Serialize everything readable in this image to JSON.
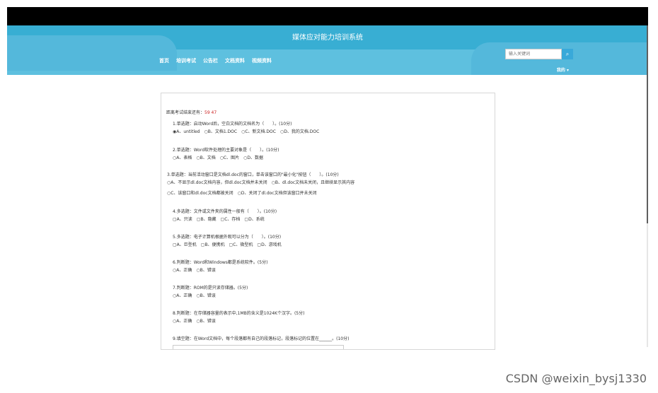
{
  "header": {
    "title": "媒体应对能力培训系统",
    "nav": [
      "首页",
      "培训考试",
      "公告栏",
      "文档资料",
      "视频资料"
    ],
    "search_placeholder": "输入关键词",
    "search_icon": "search-icon",
    "user_label": "我的 ▾"
  },
  "exam": {
    "timer_label": "距离考试结束还有：",
    "timer_value": "59 47",
    "questions": [
      {
        "title": "1.单选题：启动Word后，空白文档的文档名为（　　）。(10分)",
        "options": "◉A、untitled　○B、文档1.DOC　○C、新文档.DOC　○D、我的文档.DOC"
      },
      {
        "title": "2.单选题：Word软件处理的主要对象是（　　）。(10分)",
        "options": "○A、表格　○B、文档　○C、图片　○D、数据"
      },
      {
        "title": "3.单选题：当前活动窗口是文档dl.doc的窗口，单击该窗口的\"最小化\"按钮（　　）。(10分)",
        "options": "○A、不显示dl.doc文档内容，但dl.doc文档并未关闭　○B、dl.doc文档未关闭，且继续显示其内容",
        "options2": "○C、该窗口和dl.doc文档都被关闭　○D、关闭了dl.doc文档但该窗口并未关闭"
      },
      {
        "title": "4.多选题：文件或文件夹的属性一般有（　　）。(10分)",
        "options": "▢A、只读　▢B、隐藏　▢C、存档　▢D、系统"
      },
      {
        "title": "5.多选题：电子计算机根据外观可以分为（　　）。(10分)",
        "options": "▢A、巨型机　▢B、便携机　▢C、微型机　▢D、游戏机"
      },
      {
        "title": "6.判断题：Word和Windows都是系统软件。(5分)",
        "options": "○A、正确　○B、错误"
      },
      {
        "title": "7.判断题：ROM的是只读存储器。(5分)",
        "options": "○A、正确　○B、错误"
      },
      {
        "title": "8.判断题：在存储器容量的表示中,1MB的含义是1024K个汉字。(5分)",
        "options": "○A、正确　○B、错误"
      },
      {
        "title": "9.填空题：在Word文档中，每个段落都有自己的段落标记，段落标记的位置在______。(10分)"
      }
    ]
  },
  "watermark": "CSDN @weixin_bysj1330"
}
